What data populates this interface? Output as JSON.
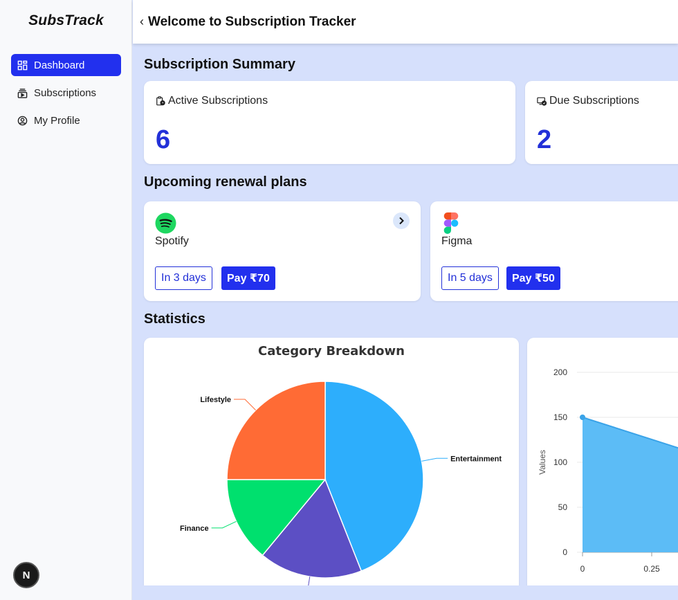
{
  "app": {
    "brand": "SubsTrack",
    "header_title": "Welcome to Subscription Tracker",
    "back_glyph": "‹"
  },
  "sidebar": {
    "items": [
      {
        "label": "Dashboard",
        "icon": "dashboard-icon",
        "active": true
      },
      {
        "label": "Subscriptions",
        "icon": "subscriptions-icon",
        "active": false
      },
      {
        "label": "My Profile",
        "icon": "profile-icon",
        "active": false
      }
    ],
    "badge": "N"
  },
  "summary": {
    "title": "Subscription Summary",
    "active_label": "Active Subscriptions",
    "active_value": "6",
    "due_label": "Due Subscriptions",
    "due_value": "2"
  },
  "upcoming": {
    "title": "Upcoming renewal plans",
    "plans": [
      {
        "name": "Spotify",
        "days": "In 3 days",
        "pay": "Pay ₹70"
      },
      {
        "name": "Figma",
        "days": "In 5 days",
        "pay": "Pay ₹50"
      }
    ]
  },
  "statistics": {
    "title": "Statistics"
  },
  "colors": {
    "accent": "#2230ee",
    "entertainment": "#2daefc",
    "lifestyle": "#ff6b35",
    "finance": "#00e06e",
    "other": "#5c4fc4",
    "area": "#5cbcf6"
  },
  "chart_data": [
    {
      "type": "pie",
      "title": "Category Breakdown",
      "slices": [
        {
          "label": "Entertainment",
          "value": 44
        },
        {
          "label": "",
          "value": 17
        },
        {
          "label": "Finance",
          "value": 14
        },
        {
          "label": "Lifestyle",
          "value": 25
        }
      ]
    },
    {
      "type": "area",
      "ylabel": "Values",
      "ylim": [
        0,
        200
      ],
      "yticks": [
        "0",
        "50",
        "100",
        "150",
        "200"
      ],
      "xticks": [
        "0",
        "0.25"
      ],
      "x": [
        0
      ],
      "values": [
        150
      ]
    }
  ]
}
